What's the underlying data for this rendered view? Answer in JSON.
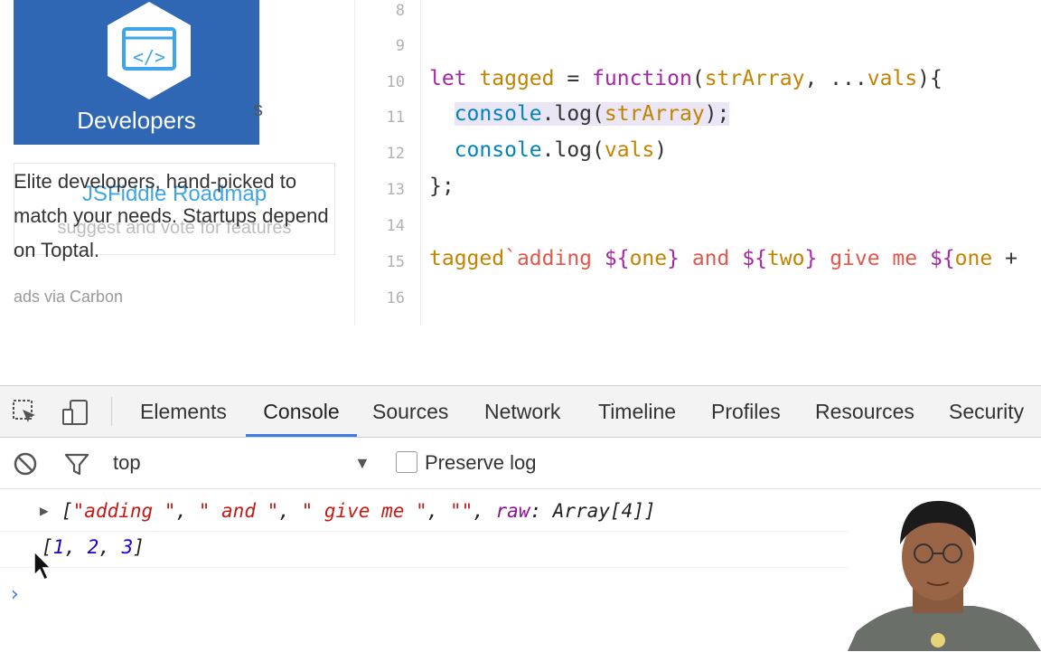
{
  "ad": {
    "image_caption": "Developers",
    "copy": "Elite developers, hand-picked to match your needs. Startups depend on Toptal.",
    "via": "ads via Carbon",
    "ghost_letter": "s"
  },
  "roadmap": {
    "title": "JSFiddle Roadmap",
    "subtitle": "suggest and vote for features"
  },
  "editor": {
    "line_numbers": [
      "8",
      "9",
      "10",
      "11",
      "12",
      "13",
      "14",
      "15",
      "16"
    ]
  },
  "devtools": {
    "tabs": [
      "Elements",
      "Console",
      "Sources",
      "Network",
      "Timeline",
      "Profiles",
      "Resources",
      "Security"
    ],
    "active_tab": "Console",
    "context": "top",
    "preserve_log": "Preserve log",
    "accent": "#3b7de0"
  },
  "console": {
    "prompt": "›"
  }
}
